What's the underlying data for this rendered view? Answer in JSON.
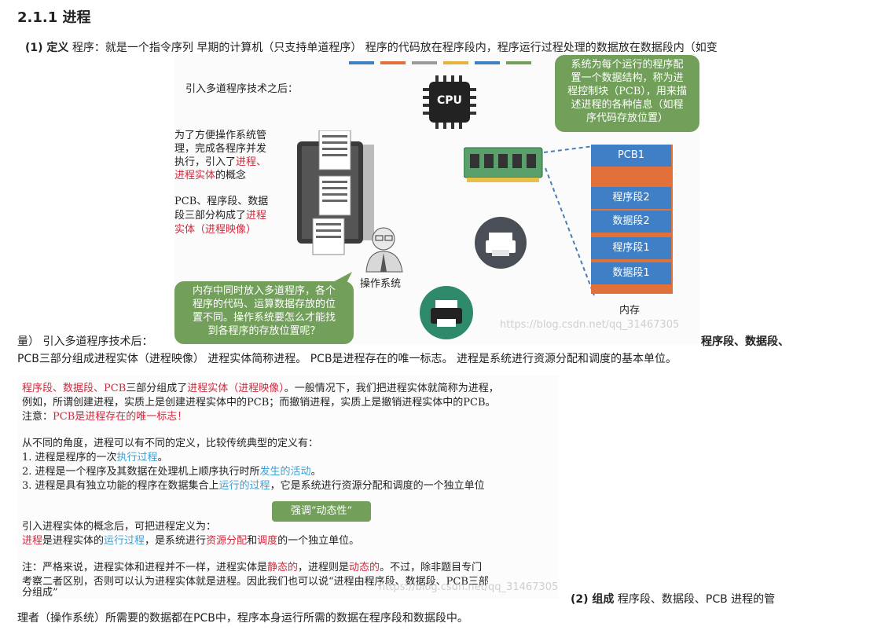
{
  "heading": "2.1.1 进程",
  "para1": {
    "label": "(1) 定义",
    "text": " 程序：就是一个指令序列 早期的计算机（只支持单道程序） 程序的代码放在程序段内，程序运行过程处理的数据放在数据段内（如变"
  },
  "slide": {
    "intro": "引入多道程序技术之后：",
    "text_a_line1": "为了方便操作系统管",
    "text_a_line2": "理，完成各程序并发",
    "text_a_line3": "执行，引入了",
    "text_a_red1": "进程、",
    "text_a_red2": "进程实体",
    "text_a_tail": "的概念",
    "text_b_line1": "PCB、程序段、数据",
    "text_b_line2": "段三部分构成了",
    "text_b_red1": "进程",
    "text_b_red2": "实体（进程映像）",
    "os_label": "操作系统",
    "cpu_label": "CPU",
    "bubble_top": [
      "系统为每个运行的程序配",
      "置一个数据结构，称为进",
      "程控制块（PCB），用来描",
      "述进程的各种信息（如程",
      "序代码存放位置）"
    ],
    "bubble_bottom": [
      "内存中同时放入多道程序，各个",
      "程序的代码、运算数据存放的位",
      "置不同。操作系统要怎么才能找",
      "到各程序的存放位置呢？"
    ],
    "memory_blocks": [
      "PCB1",
      "",
      "程序段2",
      "数据段2",
      "程序段1",
      "数据段1"
    ],
    "memory_label": "内存",
    "watermark": "https://blog.csdn.net/qq_31467305"
  },
  "para1_cont": {
    "left": "量） 引入多道程序技术后：",
    "right": "程序段、数据段、",
    "line2": "PCB三部分组成进程实体（进程映像） 进程实体简称进程。 PCB是进程存在的唯一标志。 进程是系统进行资源分配和调度的基本单位。"
  },
  "notes": {
    "l1_red": "程序段、数据段、PCB",
    "l1_mid": "三部分组成了",
    "l1_red2": "进程实体（进程映像）",
    "l1_tail": "。一般情况下，我们把进程实体就简称为进程，",
    "l2": "例如，所谓创建进程，实质上是创建进程实体中的PCB；而撤销进程，实质上是撤销进程实体中的PCB。",
    "l3_a": "注意：",
    "l3_red": "PCB是进程存在的唯一标志！",
    "l4": "从不同的角度，进程可以有不同的定义，比较传统典型的定义有：",
    "l5_a": "1.  进程是程序的一次",
    "l5_blue": "执行过程",
    "l5_b": "。",
    "l6_a": "2.  进程是一个程序及其数据在处理机上顺序执行时所",
    "l6_blue": "发生的活动",
    "l6_b": "。",
    "l7_a": "3.  进程是具有独立功能的程序在数据集合上",
    "l7_blue": "运行的过程",
    "l7_b": "，它是系统进行资源分配和调度的一个独立单位",
    "bubble": "强调“动态性”",
    "l8": "引入进程实体的概念后，可把进程定义为：",
    "l9_red": "进程",
    "l9_a": "是进程实体的",
    "l9_blue": "运行过程",
    "l9_b": "，是系统进行",
    "l9_red2": "资源分配",
    "l9_c": "和",
    "l9_red3": "调度",
    "l9_d": "的一个独立单位。",
    "l10_a": "注：严格来说，进程实体和进程并不一样，进程实体是",
    "l10_red": "静态的",
    "l10_b": "，进程则是",
    "l10_red2": "动态的",
    "l10_c": "。不过，除非题目专门",
    "l11": "考察二者区别，否则可以认为进程实体就是进程。因此我们也可以说“进程由程序段、数据段、PCB三部",
    "l12": "分组成”",
    "watermark": "https://blog.csdn.net/qq_31467305"
  },
  "para2": {
    "label": "(2) 组成",
    "text": " 程序段、数据段、PCB 进程的管",
    "line2": "理者（操作系统）所需要的数据都在PCB中，程序本身运行所需的数据在程序段和数据段中。"
  },
  "colors": {
    "bubble_green": "#72a05a",
    "mem_blue": "#3f7fc5",
    "mem_orange": "#e2703a",
    "red_text": "#d1283c",
    "blue_text": "#3aa0d6"
  }
}
